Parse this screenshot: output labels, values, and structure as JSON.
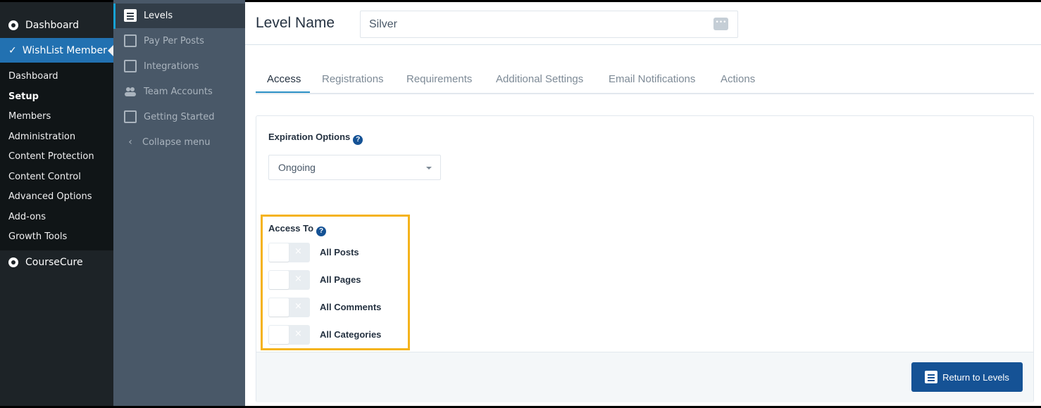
{
  "wp_sidebar": {
    "dashboard": "Dashboard",
    "wishlist_member": "WishList Member",
    "submenu": [
      "Dashboard",
      "Setup",
      "Members",
      "Administration",
      "Content Protection",
      "Content Control",
      "Advanced Options",
      "Add-ons",
      "Growth Tools"
    ],
    "current_submenu": "Setup",
    "coursecure": "CourseCure"
  },
  "wlm_sidebar": {
    "items": [
      "Levels",
      "Pay Per Posts",
      "Integrations",
      "Team Accounts",
      "Getting Started",
      "Collapse menu"
    ],
    "active": "Levels"
  },
  "header": {
    "level_name_label": "Level Name",
    "level_name_value": "Silver",
    "dots_icon": "•••"
  },
  "tabs": [
    "Access",
    "Registrations",
    "Requirements",
    "Additional Settings",
    "Email Notifications",
    "Actions"
  ],
  "active_tab": "Access",
  "access": {
    "expiration_label": "Expiration Options",
    "expiration_value": "Ongoing",
    "access_to_label": "Access To",
    "help_glyph": "?",
    "toggles": [
      {
        "label": "All Posts",
        "on": false
      },
      {
        "label": "All Pages",
        "on": false
      },
      {
        "label": "All Comments",
        "on": false
      },
      {
        "label": "All Categories",
        "on": false
      }
    ],
    "toggle_off_glyph": "×"
  },
  "footer": {
    "return_button": "Return to Levels"
  },
  "colors": {
    "wp_sidebar_bg": "#1d2327",
    "wp_active": "#2271b1",
    "wlm_sidebar_bg": "#495868",
    "accent_blue": "#155295",
    "highlight": "#f5b31b",
    "tab_underline": "#2c91c6"
  }
}
